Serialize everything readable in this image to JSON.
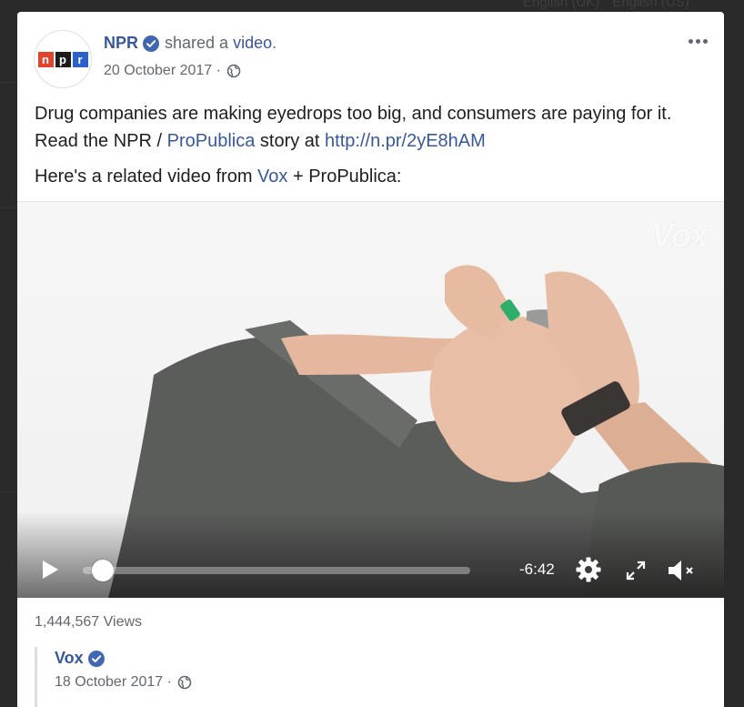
{
  "background": {
    "languages": [
      "English (UK)",
      "English (US)"
    ]
  },
  "post": {
    "page_name": "NPR",
    "action_text": "shared a",
    "action_link": "video",
    "action_suffix": ".",
    "date": "20 October 2017 ·",
    "text_line1_a": "Drug companies are making eyedrops too big, and consumers are paying for it. Read the NPR / ",
    "text_line1_link": "ProPublica",
    "text_line1_b": " story at ",
    "text_line1_url": "http://n.pr/2yE8hAM",
    "text_line2_a": "Here's a related video from ",
    "text_line2_link": "Vox",
    "text_line2_b": " + ProPublica:"
  },
  "video": {
    "watermark": "Vox",
    "time_remaining": "-6:42",
    "progress": 0.0
  },
  "views": "1,444,567 Views",
  "embedded": {
    "page_name": "Vox",
    "date": "18 October 2017 ·"
  },
  "icons": {
    "verified": "verified-badge-icon",
    "globe": "globe-icon",
    "more": "more-options-icon",
    "play": "play-icon",
    "settings": "settings-gear-icon",
    "fullscreen": "fullscreen-icon",
    "mute": "muted-speaker-icon"
  },
  "colors": {
    "link": "#385898",
    "verified": "#4267b2",
    "npr_n": "#e0442c",
    "npr_p": "#1c1c1c",
    "npr_r": "#2a62c9"
  }
}
